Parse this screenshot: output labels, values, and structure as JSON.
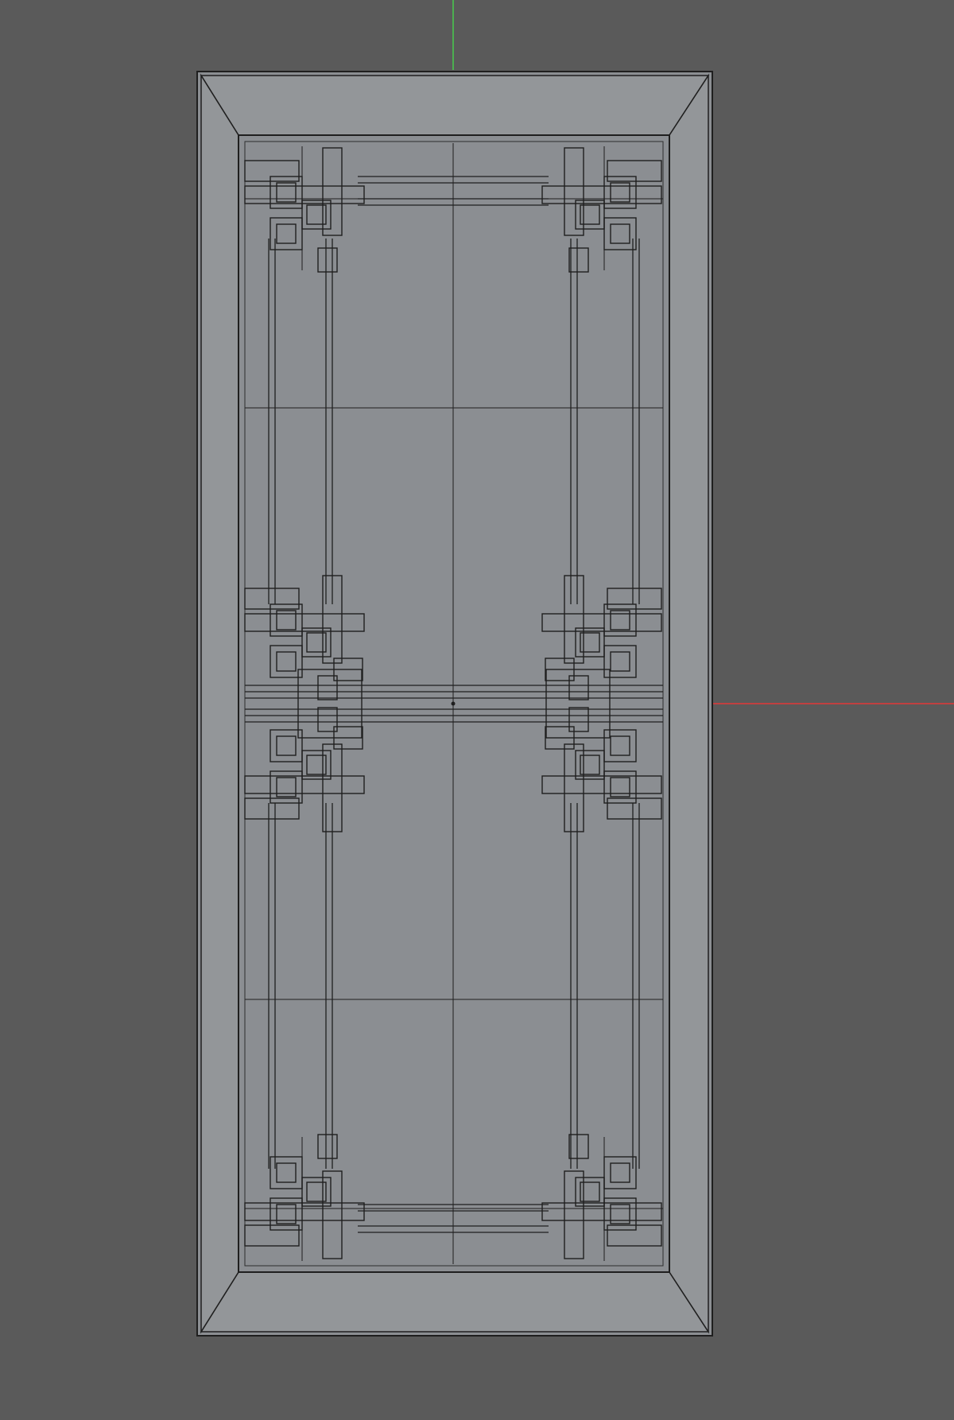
{
  "app": {
    "view_type": "3d-viewport-wireframe",
    "object": "lattice-door-panel"
  },
  "colors": {
    "background": "#5a5a5a",
    "panel_fill": "#8b8e92",
    "panel_bevel": "#939699",
    "wire": "#1f1f1f",
    "wire_light": "#2e2e2e",
    "axis_y": "#4caf50",
    "axis_x": "#c04040"
  },
  "icons": {
    "origin": "origin-dot-icon",
    "axis_x": "x-axis-line",
    "axis_y": "y-axis-line"
  }
}
